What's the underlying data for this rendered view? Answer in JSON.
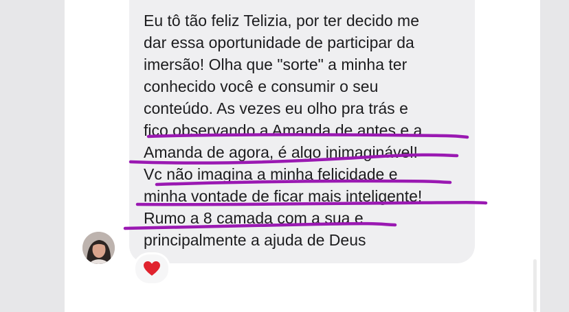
{
  "message": {
    "lines": [
      "Eu tô tão feliz Telizia, por ter decido me",
      "dar essa oportunidade de participar da",
      "imersão! Olha que \"sorte\" a minha ter",
      "conhecido você e consumir o seu",
      "conteúdo. As vezes eu olho pra trás e",
      "fico observando a Amanda de antes e a",
      "Amanda de agora, é algo inimaginável!",
      "Vc não imagina a minha felicidade e",
      "minha vontade de ficar mais inteligente!",
      "Rumo a 8 camada com a sua e",
      "principalmente a ajuda  de Deus"
    ],
    "reaction_icon": "heart-icon",
    "reaction_color": "#e0232e"
  },
  "highlight": {
    "color": "#9a19b2"
  },
  "colors": {
    "bubble": "#efeff1",
    "background": "#e7e7e9",
    "text": "#1c1c1e"
  }
}
